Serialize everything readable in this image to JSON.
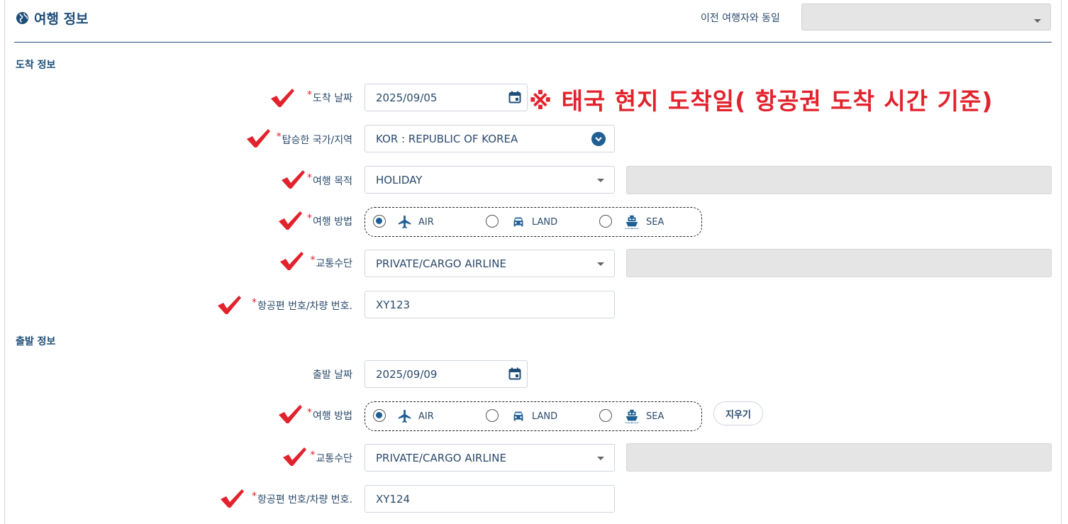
{
  "header": {
    "title": "여행 정보",
    "prev_traveler_label": "이전 여행자와 동일",
    "prev_traveler_value": ""
  },
  "arrival": {
    "section_title": "도착 정보",
    "date_label": "도착 날짜",
    "date_value": "2025/09/05",
    "note": "※ 태국 현지 도착일( 항공권 도착 시간 기준)",
    "country_label": "탑승한 국가/지역",
    "country_value": "KOR : REPUBLIC OF KOREA",
    "purpose_label": "여행 목적",
    "purpose_value": "HOLIDAY",
    "method_label": "여행 방법",
    "method_options": [
      "AIR",
      "LAND",
      "SEA"
    ],
    "method_selected": "AIR",
    "transport_label": "교통수단",
    "transport_value": "PRIVATE/CARGO AIRLINE",
    "flight_label": "항공편 번호/차량 번호.",
    "flight_value": "XY123"
  },
  "departure": {
    "section_title": "출발 정보",
    "date_label": "출발 날짜",
    "date_value": "2025/09/09",
    "method_label": "여행 방법",
    "method_options": [
      "AIR",
      "LAND",
      "SEA"
    ],
    "method_selected": "AIR",
    "clear_label": "지우기",
    "transport_label": "교통수단",
    "transport_value": "PRIVATE/CARGO AIRLINE",
    "flight_label": "항공편 번호/차량 번호.",
    "flight_value": "XY124"
  },
  "required_marker": "*",
  "colors": {
    "accent": "#1f5f94",
    "required": "#e2222c",
    "disabled": "#e5e5e5"
  }
}
